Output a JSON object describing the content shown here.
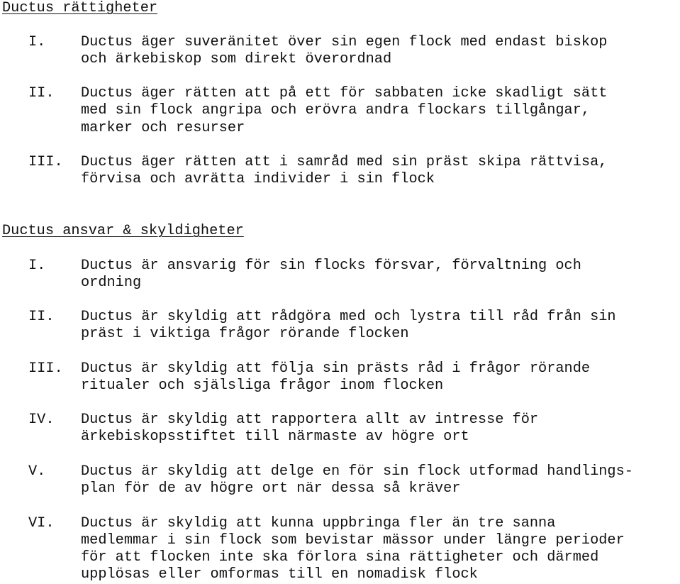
{
  "sections": [
    {
      "heading": "Ductus rättigheter",
      "items": [
        {
          "numeral": "I.",
          "lines": [
            "Ductus äger suveränitet över sin egen flock med endast biskop",
            "och ärkebiskop som direkt överordnad"
          ]
        },
        {
          "numeral": "II.",
          "lines": [
            "Ductus äger rätten att på ett för sabbaten icke skadligt sätt",
            "med sin flock angripa och erövra andra flockars tillgångar,",
            "marker och resurser"
          ]
        },
        {
          "numeral": "III.",
          "lines": [
            "Ductus äger rätten att i samråd med sin präst skipa rättvisa,",
            "förvisa och avrätta individer i sin flock"
          ]
        }
      ]
    },
    {
      "heading": "Ductus ansvar & skyldigheter",
      "items": [
        {
          "numeral": "I.",
          "lines": [
            "Ductus är ansvarig för sin flocks försvar, förvaltning och",
            "ordning"
          ]
        },
        {
          "numeral": "II.",
          "lines": [
            "Ductus är skyldig att rådgöra med och lystra till råd från sin",
            "präst i viktiga frågor rörande flocken"
          ]
        },
        {
          "numeral": "III.",
          "lines": [
            "Ductus är skyldig att följa sin prästs råd i frågor rörande",
            "ritualer och själsliga frågor inom flocken"
          ]
        },
        {
          "numeral": "IV.",
          "lines": [
            "Ductus är skyldig att rapportera allt av intresse för",
            "ärkebiskopsstiftet till närmaste av högre ort"
          ]
        },
        {
          "numeral": "V.",
          "lines": [
            "Ductus är skyldig att delge en för sin flock utformad handlings-",
            "plan för de av högre ort när dessa så kräver"
          ]
        },
        {
          "numeral": "VI.",
          "lines": [
            "Ductus är skyldig att kunna uppbringa fler än tre sanna",
            "medlemmar i sin flock som bevistar mässor under längre perioder",
            "för att flocken inte ska förlora sina rättigheter och därmed",
            "upplösas eller omformas till en nomadisk flock"
          ]
        }
      ]
    }
  ]
}
